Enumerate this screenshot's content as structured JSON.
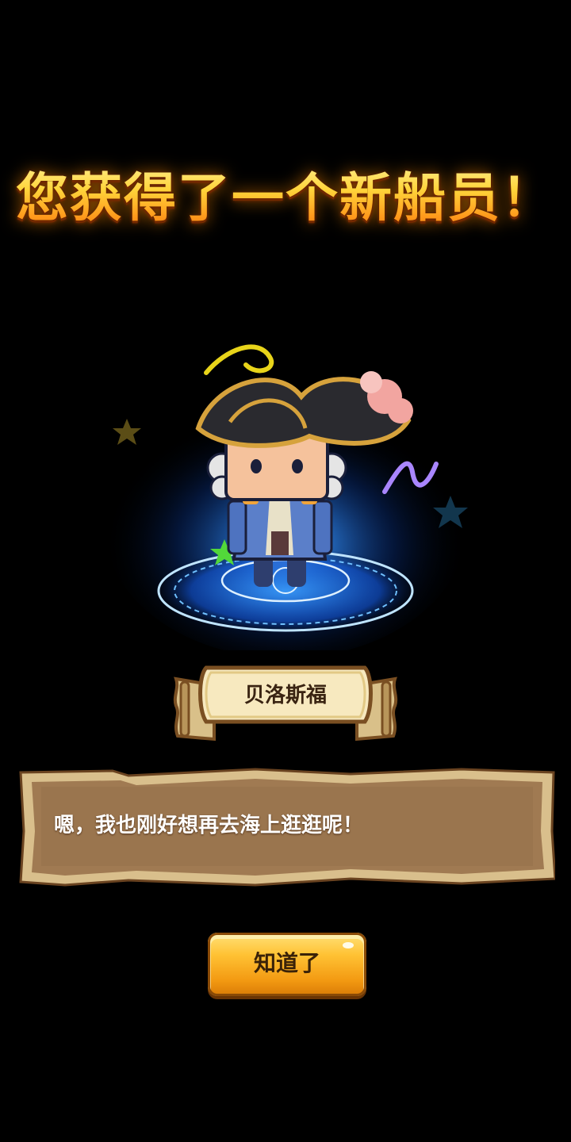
{
  "popup": {
    "title": "您获得了一个新船员！",
    "crew_name": "贝洛斯福",
    "dialog_text": "嗯，我也刚好想再去海上逛逛呢！",
    "confirm_label": "知道了"
  },
  "colors": {
    "background": "#000000",
    "title_gold": "#ffd233",
    "button_orange": "#f39a12",
    "magic_circle_blue": "#2f8cff",
    "parchment": "#a07a52"
  },
  "icons": [
    "pirate-character",
    "magic-circle",
    "star-icon",
    "name-scroll",
    "parchment-dialog"
  ]
}
